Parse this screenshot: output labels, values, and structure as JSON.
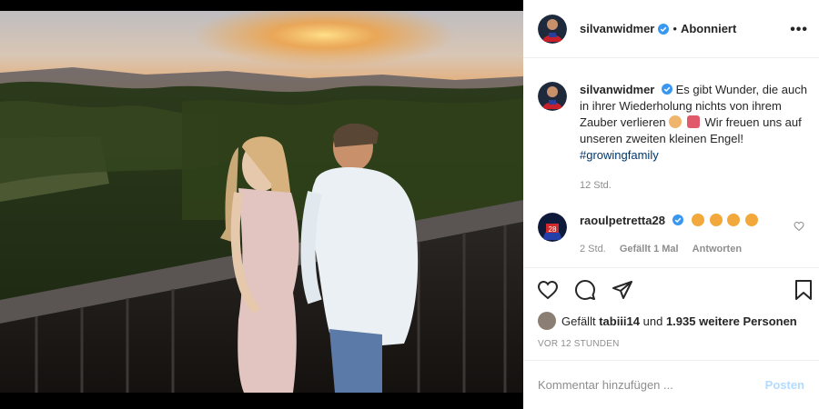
{
  "post": {
    "author": "silvanwidmer",
    "follow_status": "Abonniert",
    "more_label": "•••",
    "caption_user": "silvanwidmer",
    "caption_text": "Es gibt Wunder, die auch in ihrer Wiederholung nichts von ihrem Zauber verlieren",
    "caption_text2": "Wir freuen uns auf unseren zweiten kleinen Engel!",
    "hashtag": "#growingfamily",
    "caption_time": "12 Std.",
    "likes_user": "tabiii14",
    "likes_rest_prefix": "und",
    "likes_rest": "1.935 weitere Personen",
    "likes_prefix": "Gefällt",
    "posted_ago": "VOR 12 STUNDEN"
  },
  "comment": {
    "user": "raoulpetretta28",
    "time": "2 Std.",
    "likes": "Gefällt 1 Mal",
    "reply": "Antworten"
  },
  "add_comment": {
    "placeholder": "Kommentar hinzufügen ...",
    "post_label": "Posten"
  },
  "colors": {
    "verified": "#3897f0",
    "link": "#00376b",
    "muted": "#8e8e8e"
  }
}
